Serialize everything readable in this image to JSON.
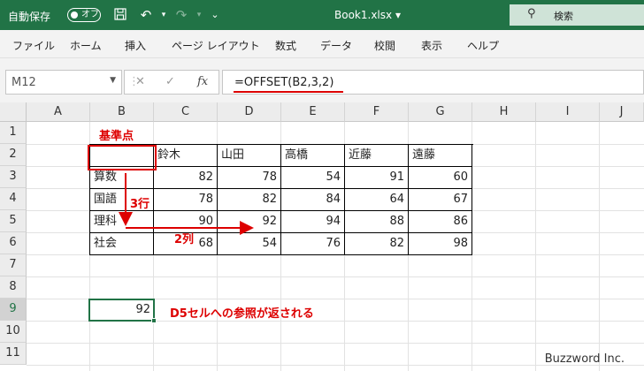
{
  "titlebar": {
    "autosave_label": "自動保存",
    "autosave_state": "オフ",
    "filename": "Book1.xlsx",
    "filename_dropdown": "▾",
    "search_placeholder": "検索"
  },
  "menu": [
    "ファイル",
    "ホーム",
    "挿入",
    "ページ レイアウト",
    "数式",
    "データ",
    "校閲",
    "表示",
    "ヘルプ"
  ],
  "formula_bar": {
    "name_box": "M12",
    "formula": "=OFFSET(B2,3,2)",
    "fx_label": "fx"
  },
  "columns": [
    "A",
    "B",
    "C",
    "D",
    "E",
    "F",
    "G",
    "H",
    "I",
    "J"
  ],
  "rows": [
    "1",
    "2",
    "3",
    "4",
    "5",
    "6",
    "7",
    "8",
    "9",
    "10",
    "11"
  ],
  "table": {
    "header": [
      "",
      "鈴木",
      "山田",
      "高橋",
      "近藤",
      "遠藤"
    ],
    "body": [
      {
        "label": "算数",
        "values": [
          "82",
          "78",
          "54",
          "91",
          "60"
        ]
      },
      {
        "label": "国語",
        "values": [
          "78",
          "82",
          "84",
          "64",
          "67"
        ]
      },
      {
        "label": "理科",
        "values": [
          "90",
          "92",
          "94",
          "88",
          "86"
        ]
      },
      {
        "label": "社会",
        "values": [
          "68",
          "54",
          "76",
          "82",
          "98"
        ]
      }
    ]
  },
  "result_cell": "92",
  "annotations": {
    "base_point": "基準点",
    "rows_offset": "3行",
    "cols_offset": "2列",
    "result_note": "D5セルへの参照が返される",
    "accent_color": "#d00000"
  },
  "watermark": "Buzzword Inc.",
  "colors": {
    "excel_green": "#217346"
  }
}
